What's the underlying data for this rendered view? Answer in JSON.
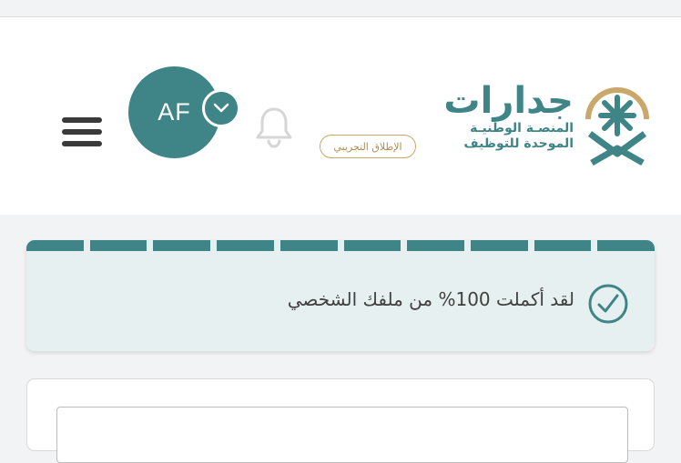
{
  "header": {
    "avatar_initials": "AF",
    "pilot_badge": "الإطلاق التجريبي",
    "logo": {
      "title": "جدارات",
      "subtitle_line1": "المنصـة الوطنيـة",
      "subtitle_line2": "الموحدة للتوظيف"
    }
  },
  "profile_progress": {
    "segments_filled": 10,
    "segments_total": 10,
    "message": "لقد أكملت 100% من ملفك الشخصي"
  },
  "colors": {
    "primary": "#3f8587",
    "gold": "#c9a86a",
    "card_bg": "#e7f0f1",
    "page_bg": "#f2f3f5"
  },
  "icons": [
    "menu-icon",
    "chevron-down-icon",
    "bell-icon",
    "check-circle-icon",
    "jadarat-emblem"
  ]
}
